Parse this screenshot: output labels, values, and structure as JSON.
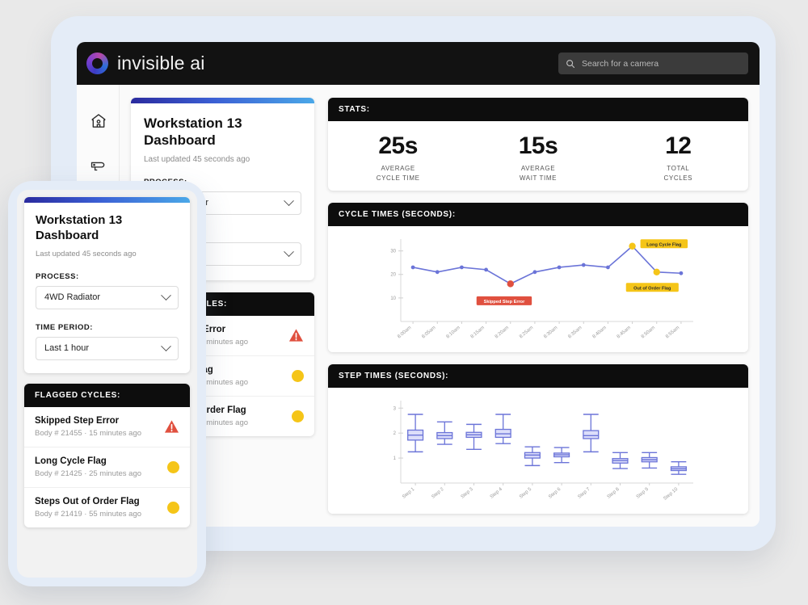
{
  "app": {
    "brand": "invisible ai",
    "search_placeholder": "Search for a camera"
  },
  "sidebar": {
    "items": [
      {
        "name": "home",
        "icon": "home-icon"
      },
      {
        "name": "cameras",
        "icon": "camera-icon"
      }
    ]
  },
  "dashboard": {
    "title_line1": "Workstation 13",
    "title_line2": "Dashboard",
    "last_updated": "Last updated 45 seconds ago",
    "process_label": "PROCESS:",
    "process_value": "4WD Radiator",
    "time_period_label": "TIME PERIOD:",
    "time_period_value": "Last 1 hour"
  },
  "flagged": {
    "header": "FLAGGED CYCLES:",
    "rows": [
      {
        "name": "Skipped Step Error",
        "meta": "Body # 21455  ·  15 minutes ago",
        "status": "error"
      },
      {
        "name": "Long Cycle Flag",
        "meta": "Body # 21425  ·  25 minutes ago",
        "status": "warn"
      },
      {
        "name": "Steps Out of Order Flag",
        "meta": "Body # 21419  ·  55 minutes ago",
        "status": "warn"
      }
    ]
  },
  "stats": {
    "header": "STATS:",
    "items": [
      {
        "value": "25s",
        "label_line1": "AVERAGE",
        "label_line2": "CYCLE TIME"
      },
      {
        "value": "15s",
        "label_line1": "AVERAGE",
        "label_line2": "WAIT TIME"
      },
      {
        "value": "12",
        "label_line1": "TOTAL",
        "label_line2": "CYCLES"
      }
    ]
  },
  "colors": {
    "accent_blue": "#6b74d8",
    "warn_yellow": "#f5c518",
    "error_red": "#e0503f",
    "header_black": "#0d0d0d"
  },
  "chart_data": [
    {
      "type": "line",
      "title": "CYCLE TIMES (SECONDS):",
      "xlabel": "",
      "ylabel": "",
      "ylim": [
        0,
        35
      ],
      "yticks": [
        10,
        20,
        30
      ],
      "grid": false,
      "categories": [
        "8:00am",
        "8:05am",
        "8:10am",
        "8:15am",
        "8:20am",
        "8:25am",
        "8:30am",
        "8:35am",
        "8:40am",
        "8:45am",
        "8:50am",
        "8:55am"
      ],
      "values": [
        23,
        21,
        23,
        22,
        16,
        21,
        23,
        24,
        23,
        32,
        21,
        20.5
      ],
      "point_colors": [
        "#6b74d8",
        "#6b74d8",
        "#6b74d8",
        "#6b74d8",
        "#e0503f",
        "#6b74d8",
        "#6b74d8",
        "#6b74d8",
        "#6b74d8",
        "#f5c518",
        "#f5c518",
        "#6b74d8"
      ],
      "annotations": [
        {
          "index": 4,
          "text": "Skipped Step Error",
          "style": "error"
        },
        {
          "index": 9,
          "text": "Long Cycle Flag",
          "style": "warn"
        },
        {
          "index": 10,
          "text": "Out of Order Flag",
          "style": "warn"
        }
      ]
    },
    {
      "type": "box",
      "title": "STEP TIMES (SECONDS):",
      "xlabel": "",
      "ylabel": "",
      "ylim": [
        0,
        3.3
      ],
      "yticks": [
        1,
        2,
        3
      ],
      "grid": false,
      "categories": [
        "Step 1",
        "Step 2",
        "Step 3",
        "Step 4",
        "Step 5",
        "Step 6",
        "Step 7",
        "Step 8",
        "Step 9",
        "Step 10"
      ],
      "boxes": [
        {
          "min": 1.25,
          "q1": 1.72,
          "med": 1.92,
          "q3": 2.12,
          "max": 2.75
        },
        {
          "min": 1.55,
          "q1": 1.78,
          "med": 1.9,
          "q3": 2.02,
          "max": 2.45
        },
        {
          "min": 1.35,
          "q1": 1.83,
          "med": 1.93,
          "q3": 2.03,
          "max": 2.35
        },
        {
          "min": 1.58,
          "q1": 1.83,
          "med": 1.97,
          "q3": 2.15,
          "max": 2.75
        },
        {
          "min": 0.7,
          "q1": 1.0,
          "med": 1.12,
          "q3": 1.22,
          "max": 1.45
        },
        {
          "min": 0.82,
          "q1": 1.05,
          "med": 1.13,
          "q3": 1.2,
          "max": 1.42
        },
        {
          "min": 1.25,
          "q1": 1.78,
          "med": 1.9,
          "q3": 2.1,
          "max": 2.75
        },
        {
          "min": 0.58,
          "q1": 0.8,
          "med": 0.9,
          "q3": 0.98,
          "max": 1.22
        },
        {
          "min": 0.6,
          "q1": 0.85,
          "med": 0.93,
          "q3": 1.02,
          "max": 1.22
        },
        {
          "min": 0.35,
          "q1": 0.5,
          "med": 0.57,
          "q3": 0.65,
          "max": 0.85
        }
      ]
    }
  ]
}
